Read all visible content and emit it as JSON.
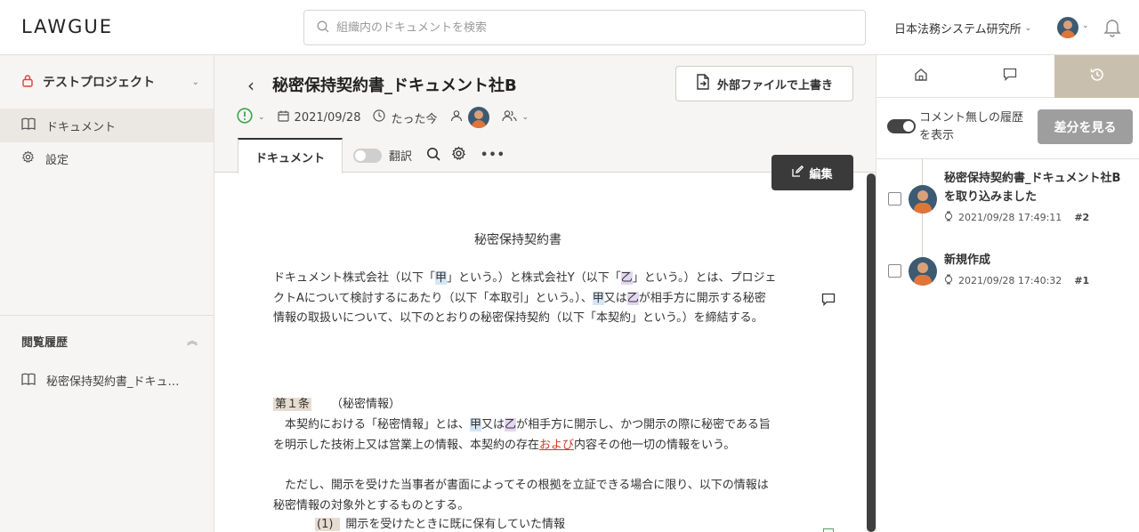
{
  "header": {
    "logo": "LAWGUE",
    "search_placeholder": "組織内のドキュメントを検索",
    "org_name": "日本法務システム研究所"
  },
  "sidebar": {
    "project_name": "テストプロジェクト",
    "items": [
      {
        "label": "ドキュメント",
        "icon": "book-icon",
        "active": true
      },
      {
        "label": "設定",
        "icon": "gear-icon",
        "active": false
      }
    ],
    "history_title": "閲覧履歴",
    "history_items": [
      {
        "label": "秘密保持契約書_ドキュ…",
        "icon": "book-icon"
      }
    ]
  },
  "document": {
    "title": "秘密保持契約書_ドキュメント社B",
    "date": "2021/09/28",
    "updated": "たった今",
    "external_button": "外部ファイルで上書き",
    "tab_label": "ドキュメント",
    "translate_label": "翻訳",
    "edit_button": "編集",
    "heading": "秘密保持契約書",
    "p1": {
      "a": "ドキュメント株式会社（以下「",
      "kou1": "甲",
      "b": "」という。）と株式会社Y（以下「",
      "otsu1": "乙",
      "c": "」という。）とは、プロジェクトAについて検討するにあたり（以下「本取引」という。）、",
      "kou2": "甲",
      "d": "又は",
      "otsu2": "乙",
      "e": "が相手方に開示する秘密情報の取扱いについて、以下のとおりの秘密保持契約（以下「本契約」という。）を締結する。"
    },
    "article1": {
      "number": "第１条",
      "title": "（秘密情報）"
    },
    "p2": {
      "a": "本契約における「秘密情報」とは、",
      "kou": "甲",
      "b": "又は",
      "otsu": "乙",
      "c": "が相手方に開示し、かつ開示の際に秘密である旨を明示した技術上又は営業上の情報、本契約の存在",
      "red": "および",
      "d": "内容その他一切の情報をいう。"
    },
    "p3": "ただし、開示を受けた当事者が書面によってその根拠を立証できる場合に限り、以下の情報は秘密情報の対象外とするものとする。",
    "item1": {
      "number": "(1)",
      "text": "開示を受けたときに既に保有していた情報"
    }
  },
  "history_panel": {
    "toggle_label": "コメント無しの履歴を表示",
    "diff_button": "差分を見る",
    "entries": [
      {
        "title": "秘密保持契約書_ドキュメント社Bを取り込みました",
        "timestamp": "2021/09/28 17:49:11",
        "number": "#2"
      },
      {
        "title": "新規作成",
        "timestamp": "2021/09/28 17:40:32",
        "number": "#1"
      }
    ]
  },
  "colors": {
    "sidebar_bg": "#f6f5f3",
    "active_tab": "#c9bfae",
    "lock_icon": "#e0403a",
    "status_icon": "#3aa64b",
    "dark_button": "#3a3a3a",
    "gray_button": "#9e9e9e"
  }
}
